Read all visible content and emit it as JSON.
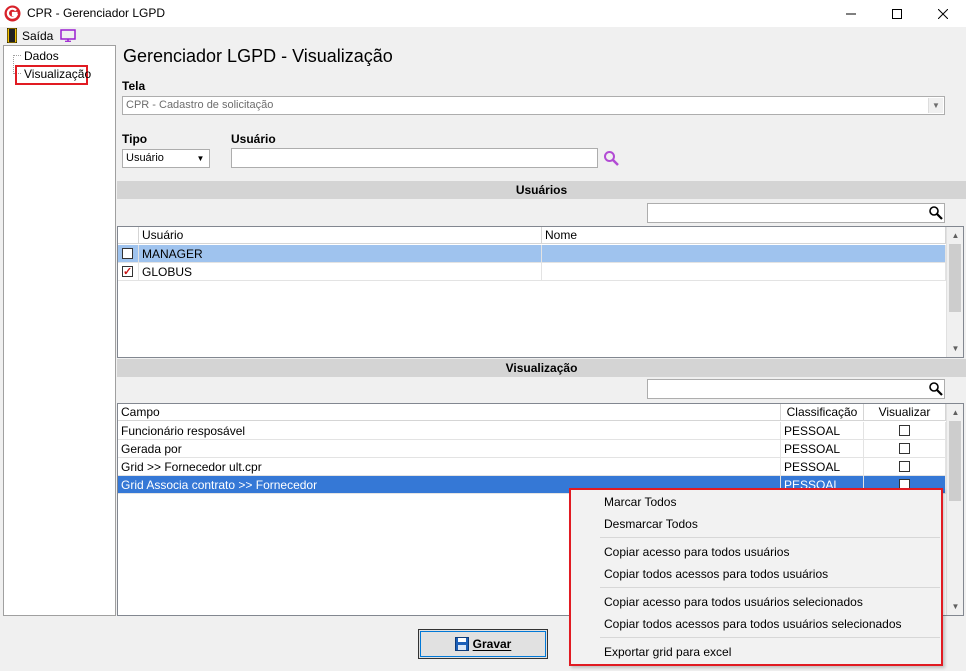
{
  "window": {
    "title": "CPR - Gerenciador LGPD"
  },
  "toolbar": {
    "exit_label": "Saída"
  },
  "tree": {
    "items": [
      {
        "label": "Dados"
      },
      {
        "label": "Visualização"
      }
    ]
  },
  "page": {
    "title": "Gerenciador LGPD - Visualização"
  },
  "tela": {
    "label": "Tela",
    "value": "CPR - Cadastro de solicitação"
  },
  "tipo": {
    "label": "Tipo",
    "value": "Usuário"
  },
  "usuario": {
    "label": "Usuário",
    "value": ""
  },
  "usuarios_section": {
    "title": "Usuários",
    "search_value": "",
    "columns": [
      "Usuário",
      "Nome"
    ],
    "rows": [
      {
        "checked": false,
        "usuario": "MANAGER",
        "nome": ""
      },
      {
        "checked": true,
        "usuario": "GLOBUS",
        "nome": ""
      }
    ]
  },
  "visualizacao_section": {
    "title": "Visualização",
    "search_value": "",
    "columns": [
      "Campo",
      "Classificação",
      "Visualizar"
    ],
    "rows": [
      {
        "campo": "Funcionário resposável",
        "classificacao": "PESSOAL",
        "visualizar": false
      },
      {
        "campo": "Gerada por",
        "classificacao": "PESSOAL",
        "visualizar": false
      },
      {
        "campo": "Grid >> Fornecedor ult.cpr",
        "classificacao": "PESSOAL",
        "visualizar": false
      },
      {
        "campo": "Grid Associa contrato >> Fornecedor",
        "classificacao": "PESSOAL",
        "visualizar": false
      }
    ]
  },
  "context_menu": {
    "items": [
      "Marcar Todos",
      "Desmarcar Todos",
      "Copiar acesso para todos usuários",
      "Copiar todos acessos para todos usuários",
      "Copiar acesso para todos usuários selecionados",
      "Copiar todos acessos para todos usuários selecionados",
      "Exportar grid para excel"
    ]
  },
  "buttons": {
    "save_label": "Gravar"
  },
  "colors": {
    "accent_red": "#e11b22",
    "selection_blue": "#3578d6"
  }
}
